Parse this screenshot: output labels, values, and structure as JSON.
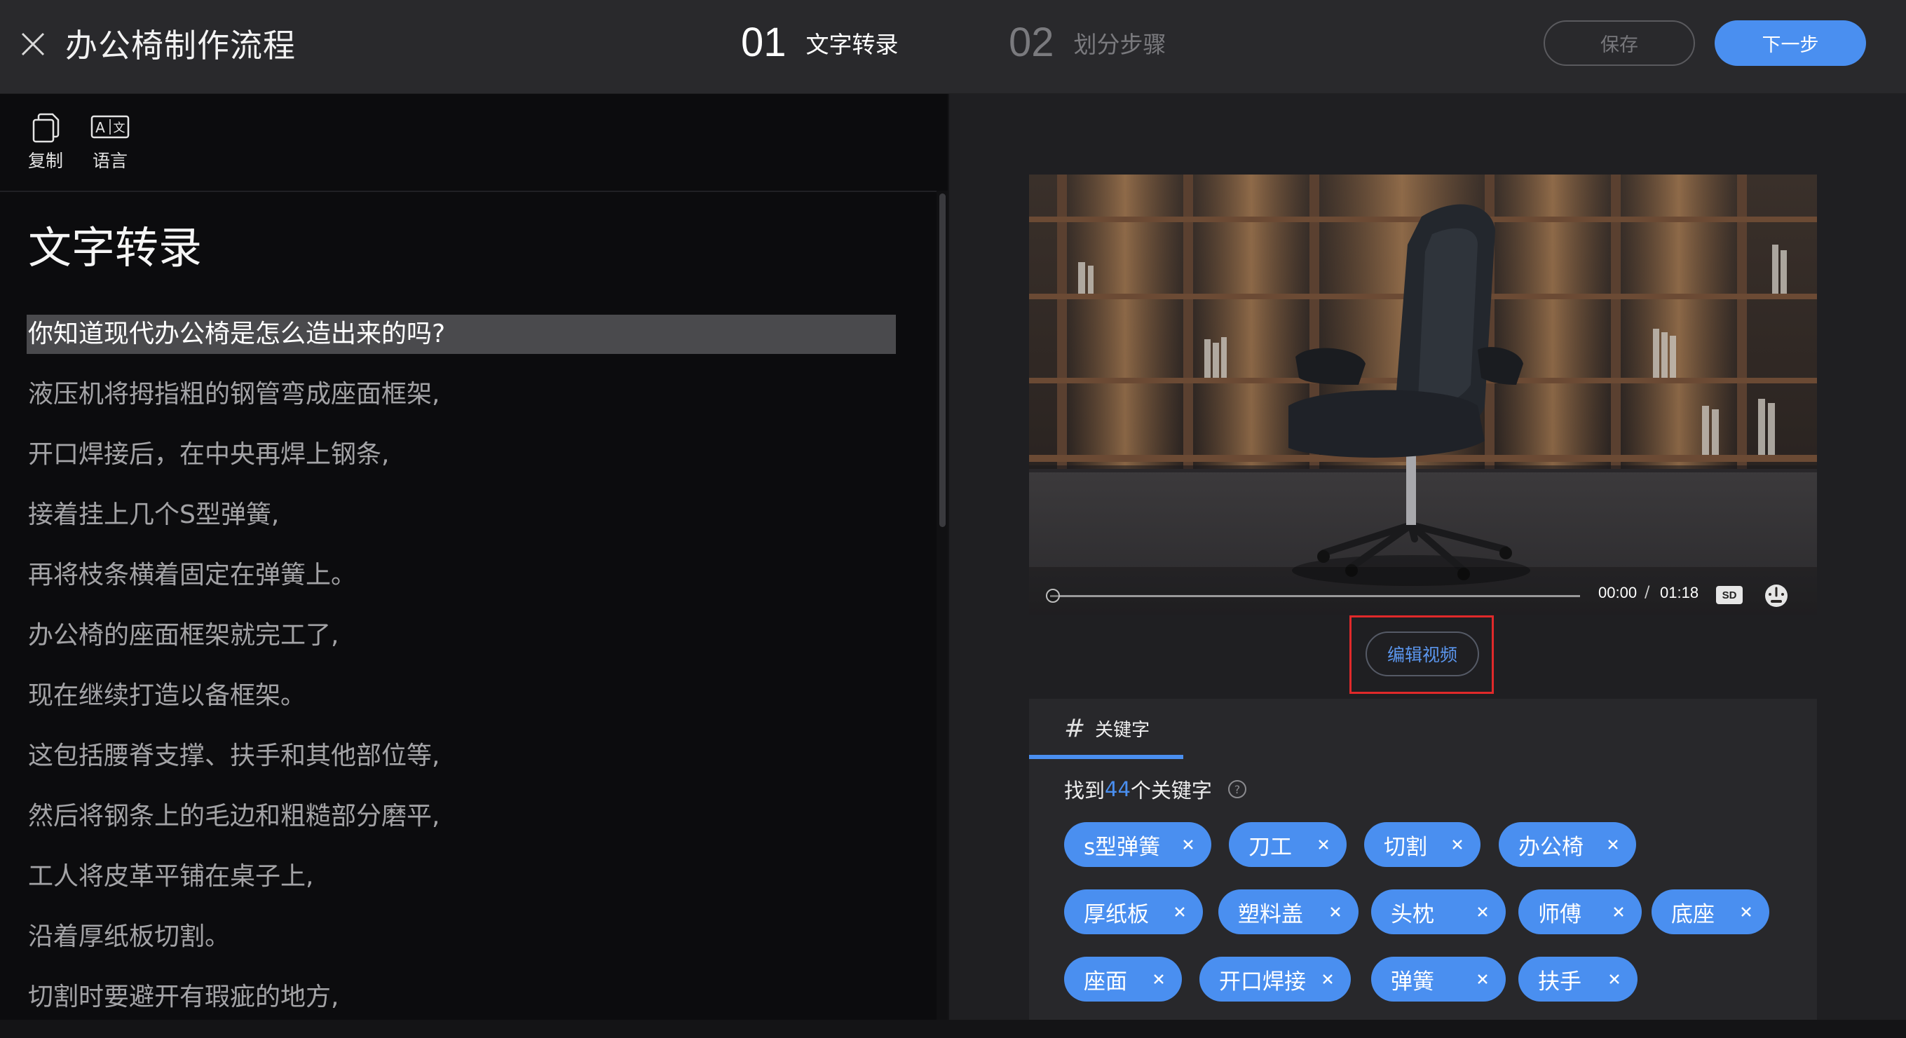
{
  "header": {
    "title": "办公椅制作流程",
    "steps": [
      {
        "num": "01",
        "label": "文字转录"
      },
      {
        "num": "02",
        "label": "划分步骤"
      }
    ],
    "save_label": "保存",
    "next_label": "下一步"
  },
  "toolbar": {
    "copy_label": "复制",
    "language_label": "语言"
  },
  "transcript": {
    "title": "文字转录",
    "lines": [
      "你知道现代办公椅是怎么造出来的吗?",
      "液压机将拇指粗的钢管弯成座面框架,",
      "开口焊接后，在中央再焊上钢条,",
      "接着挂上几个S型弹簧,",
      "再将枝条横着固定在弹簧上。",
      "办公椅的座面框架就完工了,",
      "现在继续打造以备框架。",
      "这包括腰脊支撑、扶手和其他部位等,",
      "然后将钢条上的毛边和粗糙部分磨平,",
      "工人将皮革平铺在桌子上,",
      "沿着厚纸板切割。",
      "切割时要避开有瑕疵的地方,"
    ]
  },
  "video": {
    "current_time": "00:00",
    "separator": "/",
    "duration": "01:18",
    "quality": "SD",
    "progress": 0
  },
  "edit_video_label": "编辑视频",
  "keywords": {
    "tab_label": "关键字",
    "found_prefix": "找到",
    "count": "44",
    "found_suffix": "个关键字",
    "tags": [
      "s型弹簧",
      "刀工",
      "切割",
      "办公椅",
      "厚纸板",
      "塑料盖",
      "头枕",
      "师傅",
      "底座",
      "座面",
      "开口焊接",
      "弹簧",
      "扶手"
    ]
  },
  "colors": {
    "accent": "#4a8ff0",
    "highlight_box": "#e0292a",
    "header_bg": "#29292c",
    "left_bg": "#0c0c0e",
    "right_bg": "#1f1f22"
  }
}
